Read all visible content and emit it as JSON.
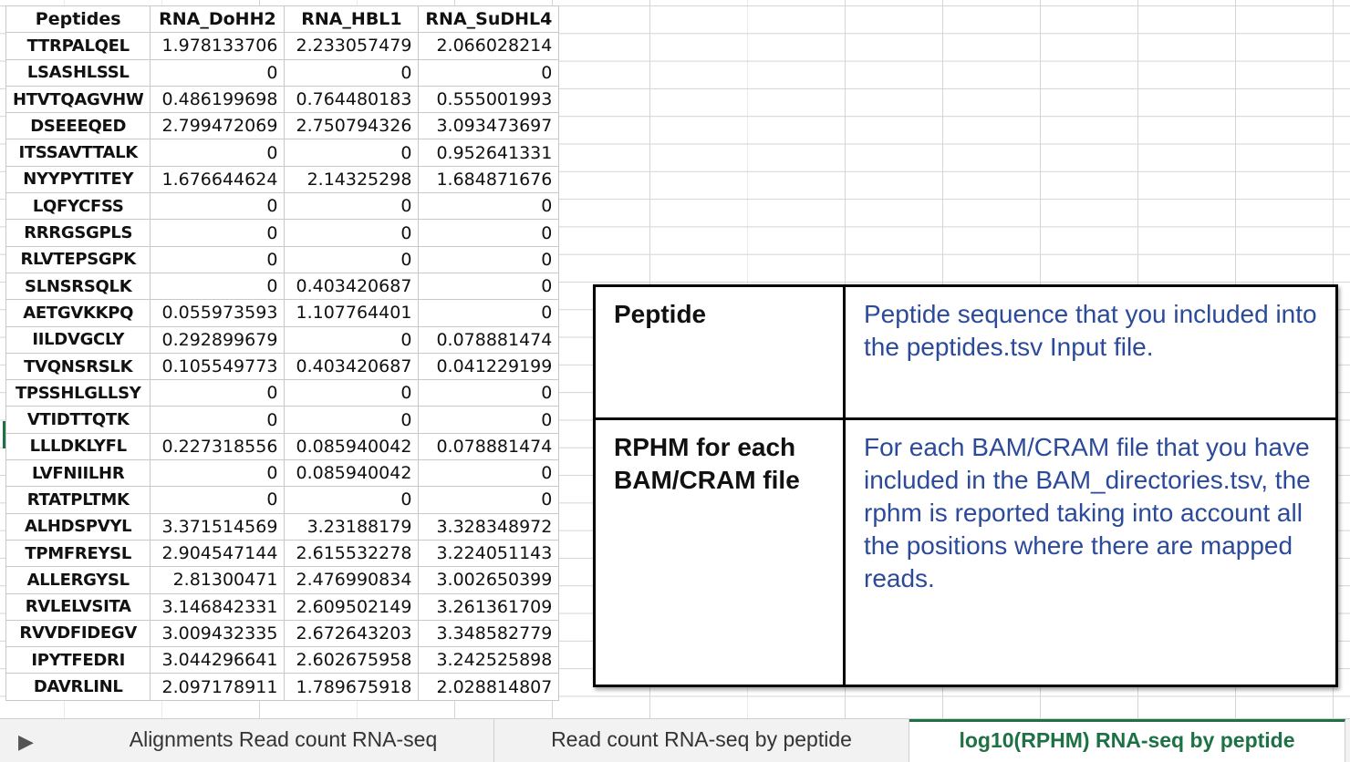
{
  "sheet": {
    "headers": [
      "Peptides",
      "RNA_DoHH2",
      "RNA_HBL1",
      "RNA_SuDHL4"
    ],
    "rows": [
      [
        "TTRPALQEL",
        "1.978133706",
        "2.233057479",
        "2.066028214"
      ],
      [
        "LSASHLSSL",
        "0",
        "0",
        "0"
      ],
      [
        "HTVTQAGVHW",
        "0.486199698",
        "0.764480183",
        "0.555001993"
      ],
      [
        "DSEEEQED",
        "2.799472069",
        "2.750794326",
        "3.093473697"
      ],
      [
        "ITSSAVTTALK",
        "0",
        "0",
        "0.952641331"
      ],
      [
        "NYYPYTITEY",
        "1.676644624",
        "2.14325298",
        "1.684871676"
      ],
      [
        "LQFYCFSS",
        "0",
        "0",
        "0"
      ],
      [
        "RRRGSGPLS",
        "0",
        "0",
        "0"
      ],
      [
        "RLVTEPSGPK",
        "0",
        "0",
        "0"
      ],
      [
        "SLNSRSQLK",
        "0",
        "0.403420687",
        "0"
      ],
      [
        "AETGVKKPQ",
        "0.055973593",
        "1.107764401",
        "0"
      ],
      [
        "IILDVGCLY",
        "0.292899679",
        "0",
        "0.078881474"
      ],
      [
        "TVQNSRSLK",
        "0.105549773",
        "0.403420687",
        "0.041229199"
      ],
      [
        "TPSSHLGLLSY",
        "0",
        "0",
        "0"
      ],
      [
        "VTIDTTQTK",
        "0",
        "0",
        "0"
      ],
      [
        "LLLDKLYFL",
        "0.227318556",
        "0.085940042",
        "0.078881474"
      ],
      [
        "LVFNIILHR",
        "0",
        "0.085940042",
        "0"
      ],
      [
        "RTATPLTMK",
        "0",
        "0",
        "0"
      ],
      [
        "ALHDSPVYL",
        "3.371514569",
        "3.23188179",
        "3.328348972"
      ],
      [
        "TPMFREYSL",
        "2.904547144",
        "2.615532278",
        "3.224051143"
      ],
      [
        "ALLERGYSL",
        "2.81300471",
        "2.476990834",
        "3.002650399"
      ],
      [
        "RVLELVSITA",
        "3.146842331",
        "2.609502149",
        "3.261361709"
      ],
      [
        "RVVDFIDEGV",
        "3.009432335",
        "2.672643203",
        "3.348582779"
      ],
      [
        "IPYTFEDRI",
        "3.044296641",
        "2.602675958",
        "3.242525898"
      ],
      [
        "DAVRLINL",
        "2.097178911",
        "1.789675918",
        "2.028814807"
      ]
    ]
  },
  "legend": {
    "row1_term": "Peptide",
    "row1_desc": "Peptide sequence that you included into the peptides.tsv Input file.",
    "row2_term": "RPHM for each BAM/CRAM file",
    "row2_desc": "For each BAM/CRAM file that you have included in the BAM_directories.tsv, the rphm is reported taking into account all the positions where there are mapped reads."
  },
  "tabs": {
    "nav_icon": "play-arrow-icon",
    "items": [
      "Alignments Read count RNA-seq",
      "Read count RNA-seq by peptide",
      "log10(RPHM) RNA-seq by peptide"
    ],
    "active_index": 2
  },
  "colors": {
    "active_tab": "#1e7145",
    "legend_desc": "#2c4a9a"
  }
}
